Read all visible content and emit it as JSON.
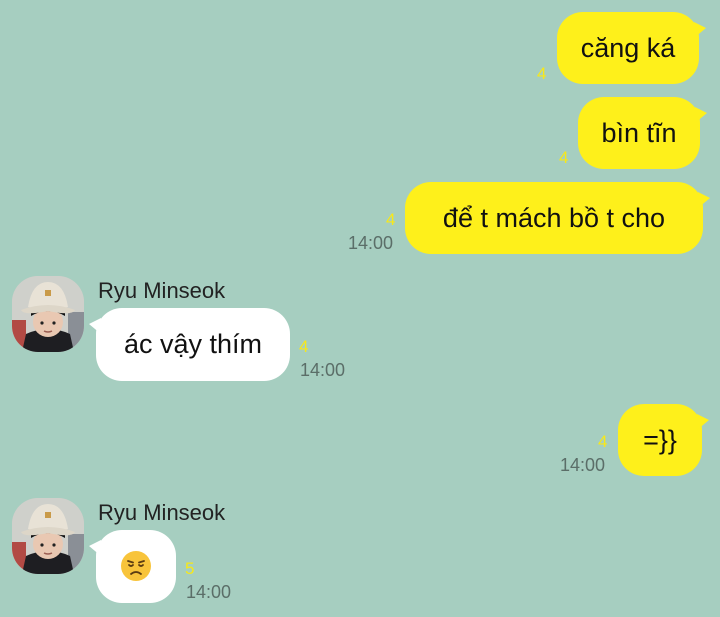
{
  "messages": [
    {
      "text": "căng ká",
      "count": "4",
      "time": ""
    },
    {
      "text": "bìn tĩn",
      "count": "4",
      "time": ""
    },
    {
      "text": "để t mách bồ t cho",
      "count": "4",
      "time": "14:00"
    },
    {
      "sender": "Ryu Minseok",
      "text": "ác vậy thím",
      "count": "4",
      "time": "14:00"
    },
    {
      "text": "=}}",
      "count": "4",
      "time": "14:00"
    },
    {
      "sender": "Ryu Minseok",
      "emoji": "disappointed-face-icon",
      "count": "5",
      "time": "14:00"
    }
  ],
  "colors": {
    "background": "#a6cec0",
    "outgoing_bubble": "#fef01b",
    "incoming_bubble": "#ffffff",
    "unread_count": "#f7e81a"
  }
}
